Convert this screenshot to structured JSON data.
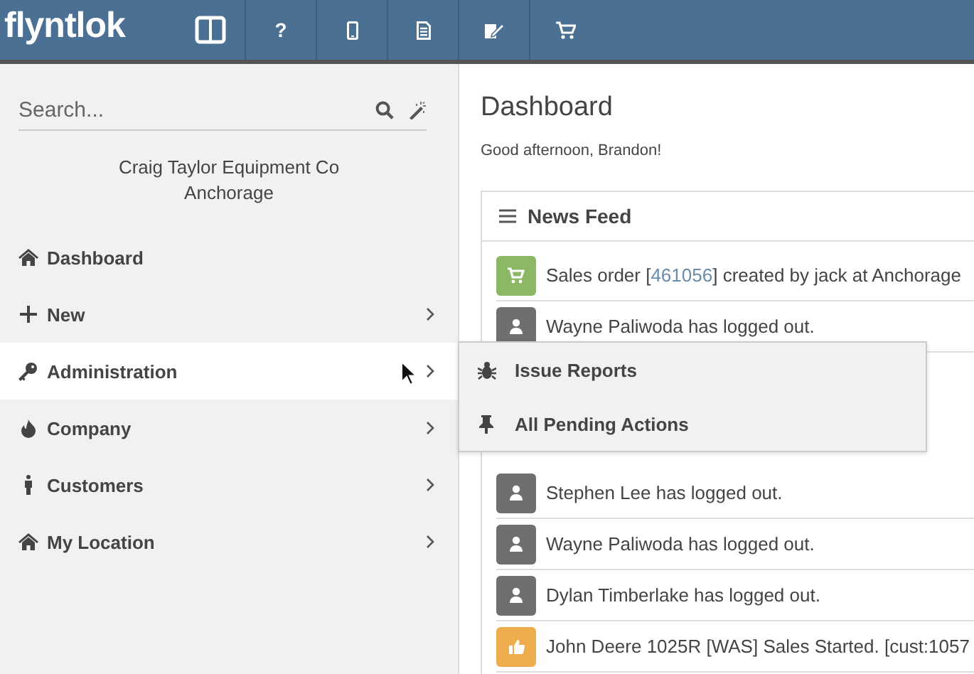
{
  "header": {
    "logo": "flyntlok",
    "tools": [
      {
        "kind": "columns"
      },
      {
        "kind": "help",
        "glyph": "?"
      },
      {
        "kind": "mobile"
      },
      {
        "kind": "document"
      },
      {
        "kind": "signature"
      },
      {
        "kind": "cart"
      }
    ]
  },
  "sidebar": {
    "search": {
      "placeholder": "Search..."
    },
    "company": "Craig Taylor Equipment Co",
    "location": "Anchorage",
    "items": [
      {
        "kind": "home",
        "label": "Dashboard",
        "arrow": false,
        "expanded": false
      },
      {
        "kind": "plus",
        "label": "New",
        "arrow": true,
        "expanded": false
      },
      {
        "kind": "key",
        "label": "Administration",
        "arrow": true,
        "expanded": true,
        "submenu": [
          {
            "kind": "bug",
            "label": "Issue Reports"
          },
          {
            "kind": "pin",
            "label": "All Pending Actions"
          }
        ]
      },
      {
        "kind": "fire",
        "label": "Company",
        "arrow": true,
        "expanded": false
      },
      {
        "kind": "person",
        "label": "Customers",
        "arrow": true,
        "expanded": false
      },
      {
        "kind": "home",
        "label": "My Location",
        "arrow": true,
        "expanded": false
      }
    ]
  },
  "main": {
    "title": "Dashboard",
    "greeting": "Good afternoon, Brandon!",
    "news_feed": {
      "title": "News Feed",
      "items": [
        {
          "kind": "sales",
          "text": "Sales order [",
          "ref": "461056",
          "text_after": "] created by jack at Anchorage"
        },
        {
          "kind": "user",
          "text": "Wayne Paliwoda has logged out."
        },
        {
          "kind": "user",
          "text": "Stephen Lee has logged out."
        },
        {
          "kind": "user",
          "text": "Wayne Paliwoda has logged out."
        },
        {
          "kind": "user",
          "text": "Dylan Timberlake has logged out."
        },
        {
          "kind": "like",
          "text": "John Deere 1025R [WAS] Sales Started. [cust:1057"
        }
      ]
    }
  }
}
